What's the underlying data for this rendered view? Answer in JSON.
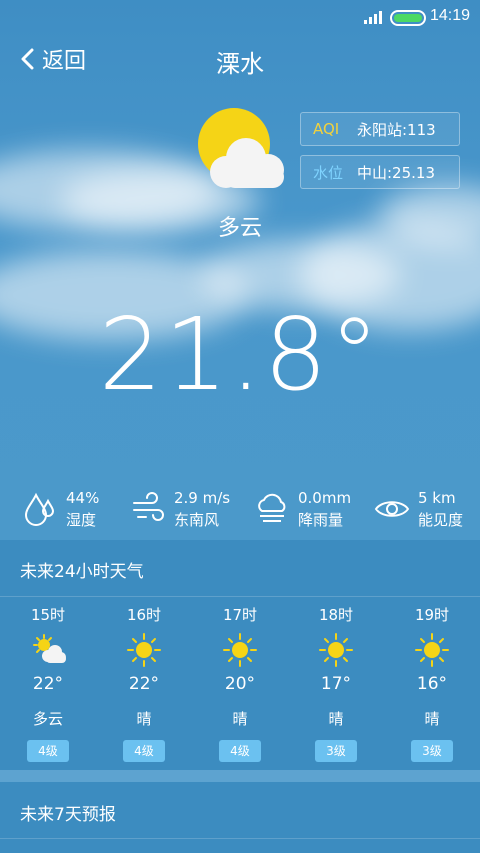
{
  "status": {
    "time": "14:19"
  },
  "header": {
    "back_label": "返回",
    "city": "溧水"
  },
  "current": {
    "condition": "多云",
    "temperature": "21.8°",
    "icon": "partly-cloudy-icon"
  },
  "info": {
    "aqi": {
      "key": "AQI",
      "value": "永阳站:113"
    },
    "water": {
      "key": "水位",
      "value": "中山:25.13"
    }
  },
  "stats": [
    {
      "value": "44%",
      "label": "湿度",
      "icon": "humidity-icon"
    },
    {
      "value": "2.9 m/s",
      "label": "东南风",
      "icon": "wind-icon"
    },
    {
      "value": "0.0mm",
      "label": "降雨量",
      "icon": "rain-icon"
    },
    {
      "value": "5 km",
      "label": "能见度",
      "icon": "eye-icon"
    }
  ],
  "hourly": {
    "title": "未来24小时天气",
    "items": [
      {
        "time": "15时",
        "temp": "22°",
        "cond": "多云",
        "wind": "4级",
        "icon": "partly-cloudy-icon"
      },
      {
        "time": "16时",
        "temp": "22°",
        "cond": "晴",
        "wind": "4级",
        "icon": "sun-icon"
      },
      {
        "time": "17时",
        "temp": "20°",
        "cond": "晴",
        "wind": "4级",
        "icon": "sun-icon"
      },
      {
        "time": "18时",
        "temp": "17°",
        "cond": "晴",
        "wind": "3级",
        "icon": "sun-icon"
      },
      {
        "time": "19时",
        "temp": "16°",
        "cond": "晴",
        "wind": "3级",
        "icon": "sun-icon"
      }
    ]
  },
  "forecast": {
    "title": "未来7天预报"
  },
  "colors": {
    "sun": "#f5d416",
    "aqi_key": "#f2d23c",
    "water_key": "#7fd3ff",
    "wind_badge": "#6bc1f0",
    "battery": "#4cd964"
  }
}
